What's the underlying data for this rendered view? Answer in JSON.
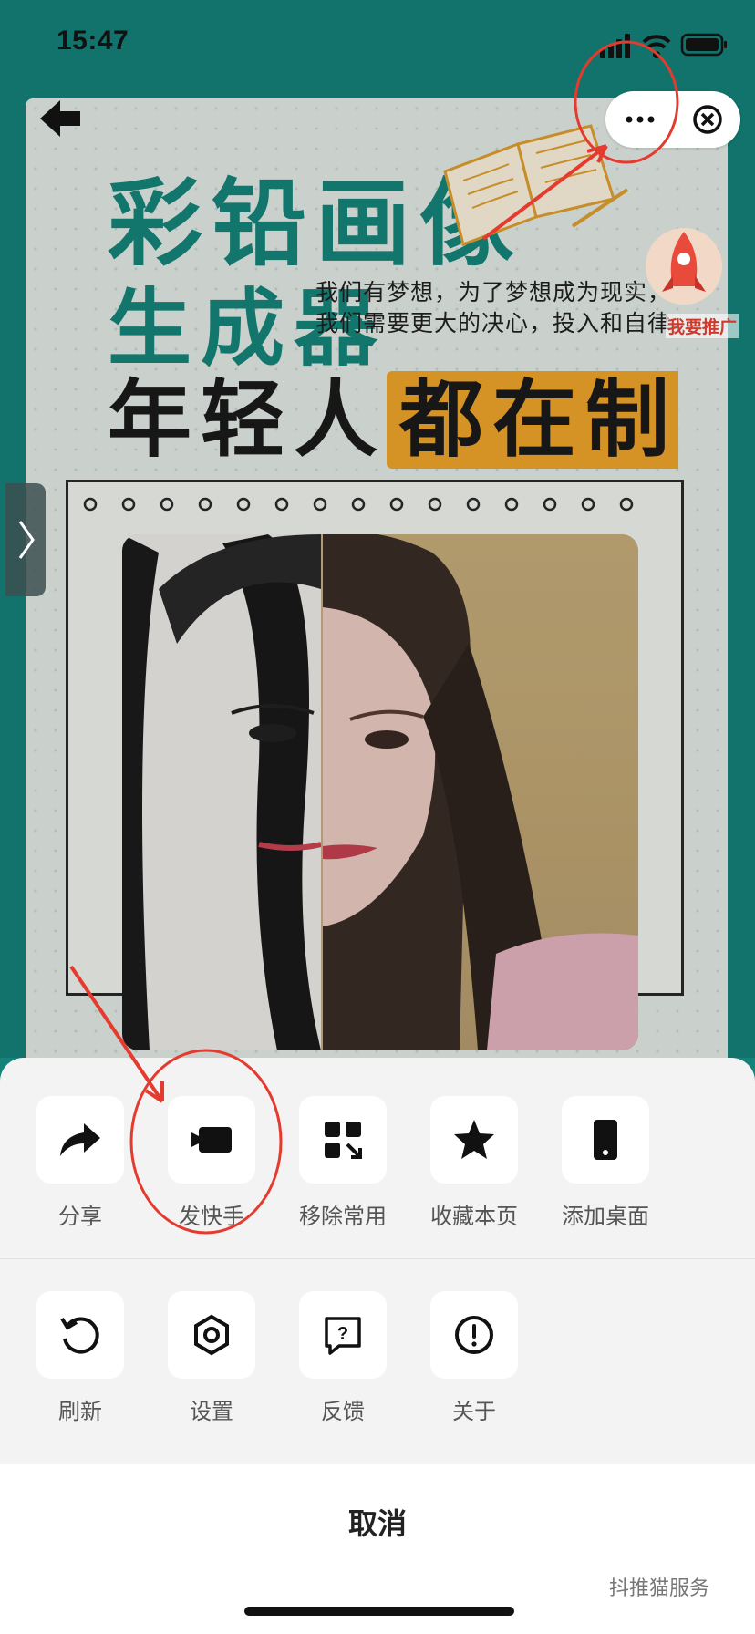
{
  "status_bar": {
    "time": "15:47",
    "icons": [
      "signal-icon",
      "wifi-icon",
      "battery-icon"
    ]
  },
  "capsule": {
    "more_icon": "more-icon",
    "close_icon": "close-circle-icon"
  },
  "poster": {
    "title_line1": "彩铅画像",
    "title_line2": "生成器",
    "title_line3_part1": "年轻人",
    "title_line3_part2": "都在制作",
    "tagline_line1": "我们有梦想，为了梦想成为现实，",
    "tagline_line2": "我们需要更大的决心，投入和自律。",
    "promo_label": "我要推广"
  },
  "action_sheet": {
    "row1": [
      {
        "label": "分享",
        "icon": "share-icon"
      },
      {
        "label": "发快手",
        "icon": "camera-icon"
      },
      {
        "label": "移除常用",
        "icon": "apps-remove-icon"
      },
      {
        "label": "收藏本页",
        "icon": "star-icon"
      },
      {
        "label": "添加桌面",
        "icon": "phone-icon"
      }
    ],
    "row2": [
      {
        "label": "刷新",
        "icon": "refresh-icon"
      },
      {
        "label": "设置",
        "icon": "settings-icon"
      },
      {
        "label": "反馈",
        "icon": "feedback-icon"
      },
      {
        "label": "关于",
        "icon": "info-icon"
      }
    ],
    "cancel": "取消"
  },
  "watermark": "抖推猫服务",
  "colors": {
    "teal": "#16877d",
    "orange": "#f3a72b",
    "annotation_red": "#e53a2e"
  }
}
